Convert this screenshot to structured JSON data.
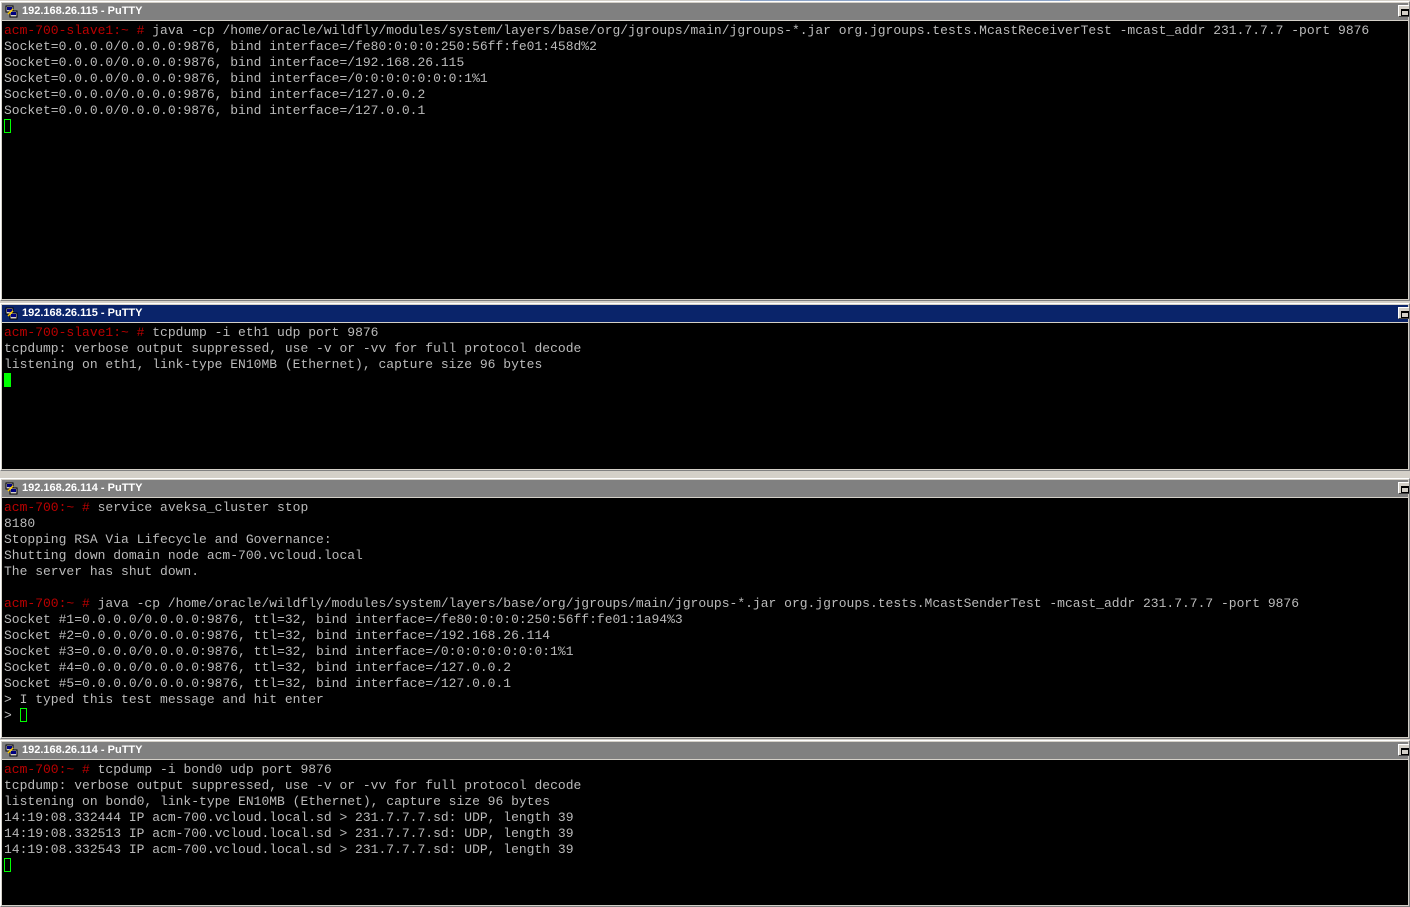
{
  "windows": [
    {
      "title": "192.168.26.115 - PuTTY",
      "active": false,
      "lines": [
        {
          "prompt": "acm-700-slave1:~ # ",
          "text": "java -cp /home/oracle/wildfly/modules/system/layers/base/org/jgroups/main/jgroups-*.jar org.jgroups.tests.McastReceiverTest -mcast_addr 231.7.7.7 -port 9876"
        },
        {
          "prompt": "",
          "text": "Socket=0.0.0.0/0.0.0.0:9876, bind interface=/fe80:0:0:0:250:56ff:fe01:458d%2"
        },
        {
          "prompt": "",
          "text": "Socket=0.0.0.0/0.0.0.0:9876, bind interface=/192.168.26.115"
        },
        {
          "prompt": "",
          "text": "Socket=0.0.0.0/0.0.0.0:9876, bind interface=/0:0:0:0:0:0:0:1%1"
        },
        {
          "prompt": "",
          "text": "Socket=0.0.0.0/0.0.0.0:9876, bind interface=/127.0.0.2"
        },
        {
          "prompt": "",
          "text": "Socket=0.0.0.0/0.0.0.0:9876, bind interface=/127.0.0.1"
        }
      ],
      "cursor": {
        "prefix": "",
        "solid": false
      }
    },
    {
      "title": "192.168.26.115 - PuTTY",
      "active": true,
      "lines": [
        {
          "prompt": "acm-700-slave1:~ # ",
          "text": "tcpdump -i eth1 udp port 9876"
        },
        {
          "prompt": "",
          "text": "tcpdump: verbose output suppressed, use -v or -vv for full protocol decode"
        },
        {
          "prompt": "",
          "text": "listening on eth1, link-type EN10MB (Ethernet), capture size 96 bytes"
        }
      ],
      "cursor": {
        "prefix": "",
        "solid": true
      }
    },
    {
      "title": "192.168.26.114 - PuTTY",
      "active": false,
      "lines": [
        {
          "prompt": "acm-700:~ # ",
          "text": "service aveksa_cluster stop"
        },
        {
          "prompt": "",
          "text": "8180"
        },
        {
          "prompt": "",
          "text": "Stopping RSA Via Lifecycle and Governance:"
        },
        {
          "prompt": "",
          "text": "Shutting down domain node acm-700.vcloud.local"
        },
        {
          "prompt": "",
          "text": "The server has shut down."
        },
        {
          "prompt": "",
          "text": ""
        },
        {
          "prompt": "acm-700:~ # ",
          "text": "java -cp /home/oracle/wildfly/modules/system/layers/base/org/jgroups/main/jgroups-*.jar org.jgroups.tests.McastSenderTest -mcast_addr 231.7.7.7 -port 9876"
        },
        {
          "prompt": "",
          "text": "Socket #1=0.0.0.0/0.0.0.0:9876, ttl=32, bind interface=/fe80:0:0:0:250:56ff:fe01:1a94%3"
        },
        {
          "prompt": "",
          "text": "Socket #2=0.0.0.0/0.0.0.0:9876, ttl=32, bind interface=/192.168.26.114"
        },
        {
          "prompt": "",
          "text": "Socket #3=0.0.0.0/0.0.0.0:9876, ttl=32, bind interface=/0:0:0:0:0:0:0:1%1"
        },
        {
          "prompt": "",
          "text": "Socket #4=0.0.0.0/0.0.0.0:9876, ttl=32, bind interface=/127.0.0.2"
        },
        {
          "prompt": "",
          "text": "Socket #5=0.0.0.0/0.0.0.0:9876, ttl=32, bind interface=/127.0.0.1"
        },
        {
          "prompt": "",
          "text": "> I typed this test message and hit enter"
        }
      ],
      "cursor": {
        "prefix": "> ",
        "solid": false
      }
    },
    {
      "title": "192.168.26.114 - PuTTY",
      "active": false,
      "lines": [
        {
          "prompt": "acm-700:~ # ",
          "text": "tcpdump -i bond0 udp port 9876"
        },
        {
          "prompt": "",
          "text": "tcpdump: verbose output suppressed, use -v or -vv for full protocol decode"
        },
        {
          "prompt": "",
          "text": "listening on bond0, link-type EN10MB (Ethernet), capture size 96 bytes"
        },
        {
          "prompt": "",
          "text": "14:19:08.332444 IP acm-700.vcloud.local.sd > 231.7.7.7.sd: UDP, length 39"
        },
        {
          "prompt": "",
          "text": "14:19:08.332513 IP acm-700.vcloud.local.sd > 231.7.7.7.sd: UDP, length 39"
        },
        {
          "prompt": "",
          "text": "14:19:08.332543 IP acm-700.vcloud.local.sd > 231.7.7.7.sd: UDP, length 39"
        }
      ],
      "cursor": {
        "prefix": "",
        "solid": false
      }
    }
  ],
  "colors": {
    "terminal_bg": "#000000",
    "terminal_fg": "#bbbbbb",
    "prompt": "#bb0000",
    "cursor": "#00ff00",
    "title_active": "#0a246a",
    "title_inactive": "#808080"
  },
  "icons": {
    "window_icon": "putty-icon",
    "window_control": "restore-icon"
  }
}
